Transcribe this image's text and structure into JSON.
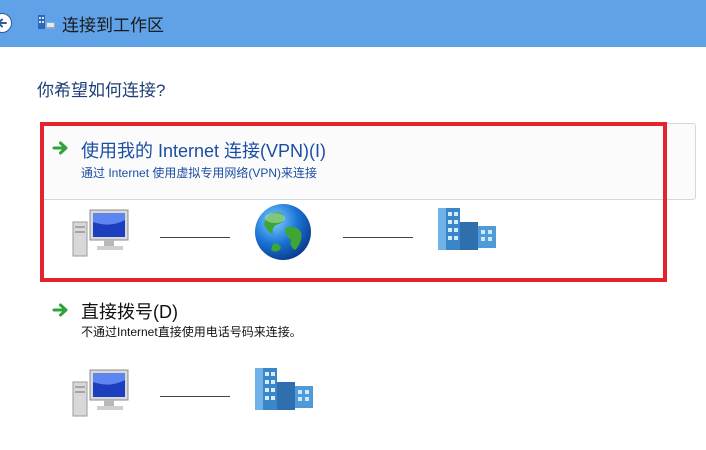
{
  "window": {
    "title": "连接到工作区",
    "back_icon": "back-arrow-icon",
    "title_icon": "network-workplace-icon",
    "title_bar_color": "#5fa2e8"
  },
  "question": "你希望如何连接?",
  "options": [
    {
      "title": "使用我的 Internet 连接(VPN)(I)",
      "description": "通过 Internet 使用虚拟专用网络(VPN)来连接",
      "icons": [
        "computer-icon",
        "globe-icon",
        "office-building-icon"
      ]
    },
    {
      "title": "直接拨号(D)",
      "description": "不通过Internet直接使用电话号码来连接。",
      "icons": [
        "computer-icon",
        "office-building-icon"
      ]
    }
  ],
  "highlight_color": "#e5232c"
}
